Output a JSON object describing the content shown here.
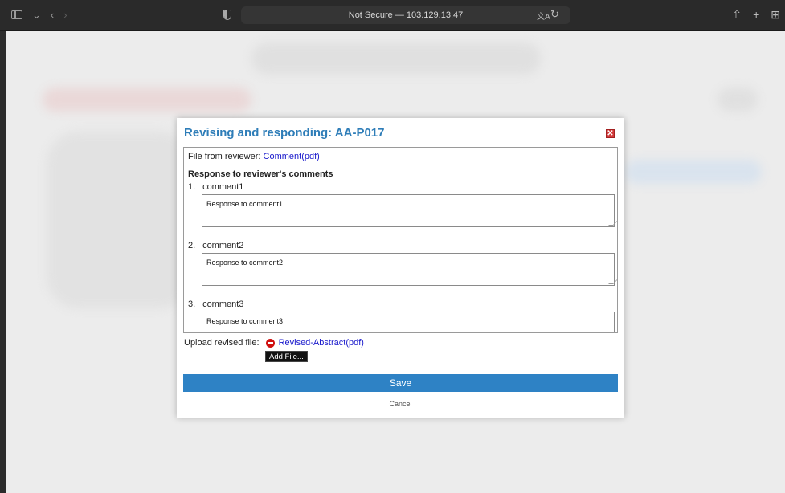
{
  "browser": {
    "address": "Not Secure — 103.129.13.47",
    "icons": [
      "sidebar-icon",
      "chevron-down-icon",
      "back-icon",
      "forward-icon",
      "shield-icon",
      "translate-icon",
      "reload-icon",
      "share-icon",
      "new-tab-icon",
      "tab-overview-icon"
    ]
  },
  "modal": {
    "title": "Revising and responding: AA-P017",
    "close_glyph": "✕",
    "reviewer_file_label": "File from reviewer:",
    "reviewer_file_link": "Comment(pdf)",
    "section_heading": "Response to reviewer's comments",
    "comments": [
      {
        "number": "1.",
        "label": "comment1",
        "response": "Response to comment1"
      },
      {
        "number": "2.",
        "label": "comment2",
        "response": "Response to comment2"
      },
      {
        "number": "3.",
        "label": "comment3",
        "response": "Response to comment3"
      }
    ],
    "upload_label": "Upload revised file:",
    "upload_link": "Revised-Abstract(pdf)",
    "add_file_label": "Add File...",
    "save_label": "Save",
    "cancel_label": "Cancel"
  },
  "colors": {
    "title": "#2e7db8",
    "save_button": "#2e82c5",
    "link": "#1a1acc",
    "close": "#d23b3b"
  }
}
